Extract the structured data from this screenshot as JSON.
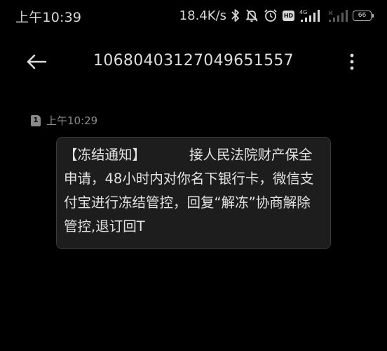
{
  "status_bar": {
    "time": "上午10:39",
    "net_speed": "18.4K/s",
    "icons": [
      "bluetooth-icon",
      "mute-bell-icon",
      "alarm-icon",
      "hd-icon",
      "signal-4g-icon",
      "signal-icon",
      "battery-icon"
    ],
    "hd_label": "HD",
    "network_label": "4G",
    "battery_level": "66"
  },
  "app_bar": {
    "back_icon": "back-arrow-icon",
    "title": "10680403127049651557",
    "more_icon": "more-vertical-icon"
  },
  "message": {
    "sim_slot": "1",
    "time": "上午10:29",
    "text": "【冻结通知】          接人民法院财产保全申请，48小时内对你名下银行卡，微信支付宝进行冻结管控，回复“解冻”协商解除管控,退订回T"
  },
  "colors": {
    "background": "#000000",
    "bubble": "#1d1d1d",
    "bubble_border": "#3a3a3a",
    "text": "#e2e2e2",
    "meta_text": "#8c8c8c"
  }
}
